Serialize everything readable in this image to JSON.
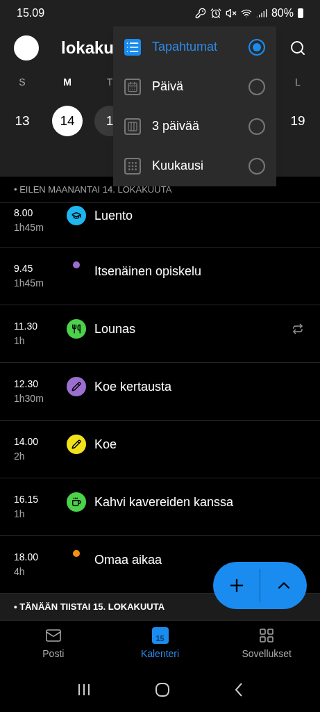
{
  "status_bar": {
    "time": "15.09",
    "battery": "80%"
  },
  "header": {
    "title": "lokaku"
  },
  "days": [
    {
      "weekday": "S",
      "date": "13",
      "selected": false,
      "today": false
    },
    {
      "weekday": "M",
      "date": "14",
      "selected": true,
      "today": false
    },
    {
      "weekday": "T",
      "date": "1",
      "selected": false,
      "today": true
    },
    {
      "weekday": "L",
      "date": "19",
      "selected": false,
      "today": false
    }
  ],
  "view_menu": [
    {
      "kind": "list",
      "label": "Tapahtumat",
      "selected": true
    },
    {
      "kind": "day",
      "label": "Päivä",
      "selected": false
    },
    {
      "kind": "three",
      "label": "3 päivää",
      "selected": false
    },
    {
      "kind": "month",
      "label": "Kuukausi",
      "selected": false
    }
  ],
  "sections": [
    {
      "title": "• EILEN MAANANTAI 14. LOKAKUUTA",
      "events": [
        {
          "time": "8.00",
          "duration": "1h45m",
          "kind": "lecture",
          "color": "#1eb6ef",
          "title": "Luento",
          "recurring": false
        },
        {
          "time": "9.45",
          "duration": "1h45m",
          "kind": "dot",
          "color": "#9b6fd0",
          "title": "Itsenäinen opiskelu",
          "recurring": false
        },
        {
          "time": "11.30",
          "duration": "1h",
          "kind": "meal",
          "color": "#4cd14a",
          "title": "Lounas",
          "recurring": true
        },
        {
          "time": "12.30",
          "duration": "1h30m",
          "kind": "pencil",
          "color": "#9b6fd0",
          "title": "Koe kertausta",
          "recurring": false
        },
        {
          "time": "14.00",
          "duration": "2h",
          "kind": "pencil",
          "color": "#f2e21a",
          "title": "Koe",
          "recurring": false
        },
        {
          "time": "16.15",
          "duration": "1h",
          "kind": "coffee",
          "color": "#4cd14a",
          "title": "Kahvi kavereiden kanssa",
          "recurring": false
        },
        {
          "time": "18.00",
          "duration": "4h",
          "kind": "dot",
          "color": "#f7900e",
          "title": "Omaa aikaa",
          "recurring": false
        }
      ]
    },
    {
      "title": "• TÄNÄÄN TIISTAI 15. LOKAKUUTA"
    }
  ],
  "bottom_nav": [
    {
      "kind": "mail",
      "label": "Posti",
      "selected": false
    },
    {
      "kind": "calendar",
      "label": "Kalenteri",
      "selected": true,
      "badge": "15"
    },
    {
      "kind": "apps",
      "label": "Sovellukset",
      "selected": false
    }
  ]
}
